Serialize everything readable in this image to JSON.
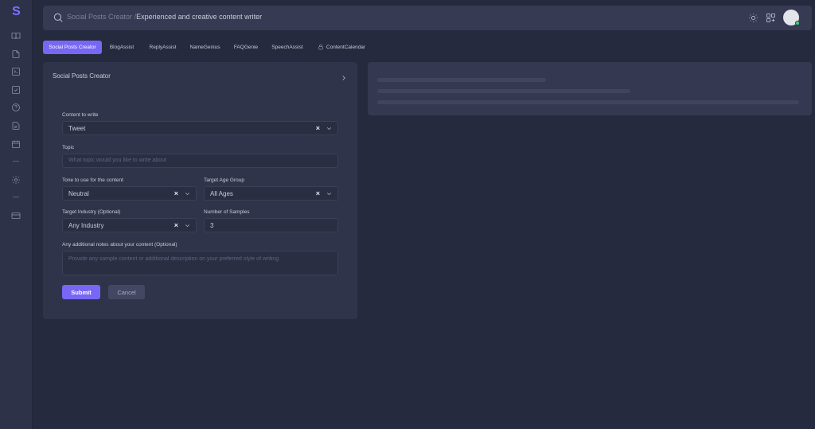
{
  "app": {
    "logo_letter": "S",
    "accent_color": "#7867f5"
  },
  "sidebar": {
    "icons": [
      "book-open-icon",
      "file-icon",
      "terminal-icon",
      "check-square-icon",
      "help-circle-icon",
      "document-icon",
      "calendar-icon",
      "settings-icon",
      "credit-card-icon"
    ]
  },
  "header": {
    "breadcrumb_parent": "Social Posts Creator",
    "breadcrumb_separator": " /",
    "breadcrumb_current": "Experienced and creative content writer"
  },
  "tabs": [
    {
      "label": "Social Posts Creator",
      "active": true
    },
    {
      "label": "BlogAssist",
      "active": false
    },
    {
      "label": "ReplyAssist",
      "active": false
    },
    {
      "label": "NameGenius",
      "active": false
    },
    {
      "label": "FAQGenie",
      "active": false
    },
    {
      "label": "SpeechAssist",
      "active": false
    },
    {
      "label": "ContentCalendar",
      "active": false,
      "locked": true
    }
  ],
  "form": {
    "title": "Social Posts Creator",
    "content_label": "Content to write",
    "content_value": "Tweet",
    "topic_label": "Topic",
    "topic_placeholder": "What topic would you like to write about",
    "tone_label": "Tone to use for the content",
    "tone_value": "Neutral",
    "age_label": "Target Age Group",
    "age_value": "All Ages",
    "industry_label": "Target Industry (Optional)",
    "industry_value": "Any Industry",
    "samples_label": "Number of Samples",
    "samples_value": "3",
    "notes_label": "Any additional notes about your content (Optional)",
    "notes_placeholder": "Provide any sample content or additional description on your preferred style of writing",
    "submit_label": "Submit",
    "cancel_label": "Cancel",
    "clear_glyph": "×"
  }
}
